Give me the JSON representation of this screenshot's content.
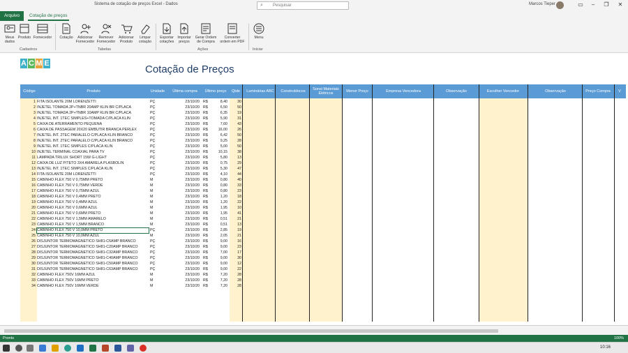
{
  "window": {
    "title": "Sistema de cotação de preços Excel - Dados",
    "user": "Marcos Tieper"
  },
  "search": {
    "placeholder": "Pesquisar"
  },
  "ribbon": {
    "tabs": [
      "Arquivo",
      "Cotação de preços"
    ],
    "buttons": [
      {
        "label": "Meus dados",
        "icon": "user-card-icon"
      },
      {
        "label": "Produto",
        "icon": "product-icon"
      },
      {
        "label": "Fornecedor",
        "icon": "supplier-icon"
      },
      {
        "label": "Cotação",
        "icon": "quote-icon"
      },
      {
        "label": "Adicionar Fornecedor",
        "icon": "add-user-icon"
      },
      {
        "label": "Remover Fornecedor",
        "icon": "remove-user-icon"
      },
      {
        "label": "Adicionar Produto",
        "icon": "add-cart-icon"
      },
      {
        "label": "Limpar cotação",
        "icon": "eraser-icon"
      },
      {
        "label": "Exportar cotações",
        "icon": "export-icon"
      },
      {
        "label": "Importar preços",
        "icon": "import-icon"
      },
      {
        "label": "Gerar Ordem de Compra",
        "icon": "order-icon"
      },
      {
        "label": "Converter ordem em PDF",
        "icon": "pdf-icon"
      },
      {
        "label": "Menu",
        "icon": "menu-icon"
      }
    ],
    "groups": [
      "Cadastros",
      "Tabelas",
      "Ações",
      "Iniciar"
    ]
  },
  "sheet": {
    "logo": [
      "A",
      "C",
      "M",
      "E"
    ],
    "heading": "Cotação de Preços",
    "headers": [
      "Código",
      "Produto",
      "Unidade",
      "Última compra",
      "Último preço",
      "Qtde",
      "Luminárias ABC",
      "Construblocos",
      "Sonsi Materiais Elétricos",
      "Menor Preço",
      "Empresa Vencedora",
      "Observação",
      "Escolher Vencedor",
      "Observação",
      "Preço Compra",
      "V"
    ],
    "rows": [
      {
        "cod": "1",
        "prod": "FITA ISOLANTE 20M LORENZETTI",
        "un": "PÇ",
        "dt": "23/10/20",
        "rs": "R$",
        "pr": "8,40",
        "q": "30"
      },
      {
        "cod": "2",
        "prod": "INJETEL TOMADA 2P+TNBR 20AMP KLIN BR C/PLACA",
        "un": "PÇ",
        "dt": "23/10/20",
        "rs": "R$",
        "pr": "6,50",
        "q": "50"
      },
      {
        "cod": "3",
        "prod": "INJETEL TOMADA 2P+TNBR 10AMP KLIN BR C/PLACA",
        "un": "PÇ",
        "dt": "23/10/20",
        "rs": "R$",
        "pr": "6,35",
        "q": "19"
      },
      {
        "cod": "4",
        "prod": "INJETEL INT. 1TEC SIMPLES+TOMADA C/PLACA KLIN",
        "un": "PÇ",
        "dt": "23/10/20",
        "rs": "R$",
        "pr": "5,90",
        "q": "31"
      },
      {
        "cod": "5",
        "prod": "CAIXA DE ATERRAMENTO PEQUENA",
        "un": "PÇ",
        "dt": "23/10/20",
        "rs": "R$",
        "pr": "7,60",
        "q": "43"
      },
      {
        "cod": "6",
        "prod": "CAIXA DE PASSAGEM 20X20 EMBUTIR BRANCA PERLEX",
        "un": "PÇ",
        "dt": "23/10/20",
        "rs": "R$",
        "pr": "16,00",
        "q": "26"
      },
      {
        "cod": "7",
        "prod": "INJETEL INT. 2TEC PARALELO C/PLACA KLIN BRANCO",
        "un": "PÇ",
        "dt": "23/10/20",
        "rs": "R$",
        "pr": "6,42",
        "q": "50"
      },
      {
        "cod": "8",
        "prod": "INJETEL INT. 2TEC PARALELO C/PLACA KLIN BRANCO",
        "un": "PÇ",
        "dt": "23/10/20",
        "rs": "R$",
        "pr": "9,25",
        "q": "28"
      },
      {
        "cod": "9",
        "prod": "INJETEL INT. 1TEC SIMPLES C/PLACA KLIN",
        "un": "PÇ",
        "dt": "23/10/20",
        "rs": "R$",
        "pr": "5,00",
        "q": "50"
      },
      {
        "cod": "10",
        "prod": "INJETEL TERMINAL COAXIAL PARA TV",
        "un": "PÇ",
        "dt": "23/10/20",
        "rs": "R$",
        "pr": "10,15",
        "q": "38"
      },
      {
        "cod": "11",
        "prod": "LAMPADA TRILUX SHORT 15W G-LIGHT",
        "un": "PÇ",
        "dt": "23/10/20",
        "rs": "R$",
        "pr": "5,80",
        "q": "13"
      },
      {
        "cod": "12",
        "prod": "CAIXA DE LUZ P/TETO 3X4 AMARELA PLASBOLIN",
        "un": "PÇ",
        "dt": "23/10/20",
        "rs": "R$",
        "pr": "0,75",
        "q": "29"
      },
      {
        "cod": "13",
        "prod": "INJETEL INT. 1TEC SIMPLES C/PLACA KLIN",
        "un": "PÇ",
        "dt": "23/10/20",
        "rs": "R$",
        "pr": "5,30",
        "q": "47"
      },
      {
        "cod": "14",
        "prod": "FITA ISOLANTE 20M LORENZETTI",
        "un": "PÇ",
        "dt": "23/10/20",
        "rs": "R$",
        "pr": "4,10",
        "q": "44"
      },
      {
        "cod": "15",
        "prod": "CABINHO FLEX 750 V 0,75MM PRETO",
        "un": "M",
        "dt": "23/10/20",
        "rs": "R$",
        "pr": "0,80",
        "q": "40"
      },
      {
        "cod": "16",
        "prod": "CABINHO FLEX 750 V 0,75MM VERDE",
        "un": "M",
        "dt": "23/10/20",
        "rs": "R$",
        "pr": "0,80",
        "q": "33"
      },
      {
        "cod": "17",
        "prod": "CABINHO FLEX 750 V 0,75MM AZUL",
        "un": "M",
        "dt": "23/10/20",
        "rs": "R$",
        "pr": "0,80",
        "q": "23"
      },
      {
        "cod": "18",
        "prod": "CABINHO FLEX 750 V 0,4MM PRETO",
        "un": "M",
        "dt": "23/10/20",
        "rs": "R$",
        "pr": "1,20",
        "q": "18"
      },
      {
        "cod": "19",
        "prod": "CABINHO FLEX 750 V 0,4MM AZUL",
        "un": "M",
        "dt": "23/10/20",
        "rs": "R$",
        "pr": "1,20",
        "q": "22"
      },
      {
        "cod": "20",
        "prod": "CABINHO FLEX 750 V 0,6MM AZUL",
        "un": "M",
        "dt": "23/10/20",
        "rs": "R$",
        "pr": "1,95",
        "q": "10"
      },
      {
        "cod": "21",
        "prod": "CABINHO FLEX 750 V 0,6MM PRETO",
        "un": "M",
        "dt": "23/10/20",
        "rs": "R$",
        "pr": "1,95",
        "q": "41"
      },
      {
        "cod": "22",
        "prod": "CABINHO FLEX 750 V 1,5MM AMARELO",
        "un": "M",
        "dt": "23/10/20",
        "rs": "R$",
        "pr": "0,51",
        "q": "21"
      },
      {
        "cod": "23",
        "prod": "CABINHO FLEX 750 V 1,5MM BRANCO",
        "un": "M",
        "dt": "23/10/20",
        "rs": "R$",
        "pr": "0,51",
        "q": "13"
      },
      {
        "cod": "24",
        "prod": "CABINHO FLEX 750 V 10,0MM PRETO",
        "un": "PÇ",
        "dt": "23/10/20",
        "rs": "R$",
        "pr": "2,85",
        "q": "19"
      },
      {
        "cod": "25",
        "prod": "CABINHO FLEX 750 V 10,0MM AZUL",
        "un": "M",
        "dt": "23/10/20",
        "rs": "R$",
        "pr": "2,05",
        "q": "21"
      },
      {
        "cod": "26",
        "prod": "DISJUNTOR TERMOMAGNETICO SH81-C6AMP BRANCO",
        "un": "PÇ",
        "dt": "23/10/20",
        "rs": "R$",
        "pr": "9,00",
        "q": "16"
      },
      {
        "cod": "27",
        "prod": "DISJUNTOR TERMOMAGNETICO SH81-C20AMP BRANCO",
        "un": "PÇ",
        "dt": "23/10/20",
        "rs": "R$",
        "pr": "9,00",
        "q": "23"
      },
      {
        "cod": "28",
        "prod": "DISJUNTOR TERMOMAGNETICO SH81-C32AMP BRANCO",
        "un": "PÇ",
        "dt": "23/10/20",
        "rs": "R$",
        "pr": "7,00",
        "q": "17"
      },
      {
        "cod": "29",
        "prod": "DISJUNTOR TERMOMAGNETICO SH81-C40AMP BRANCO",
        "un": "PÇ",
        "dt": "23/10/20",
        "rs": "R$",
        "pr": "9,00",
        "q": "30"
      },
      {
        "cod": "30",
        "prod": "DISJUNTOR TERMOMAGNETICO SH81-C50AMP BRANCO",
        "un": "PÇ",
        "dt": "23/10/20",
        "rs": "R$",
        "pr": "9,00",
        "q": "12"
      },
      {
        "cod": "31",
        "prod": "DISJUNTOR TERMOMAGNETICO SH81-C63AMP BRANCO",
        "un": "PÇ",
        "dt": "23/10/20",
        "rs": "R$",
        "pr": "9,00",
        "q": "22"
      },
      {
        "cod": "32",
        "prod": "CABINHO FLEX 750V 16MM AZUL",
        "un": "M",
        "dt": "23/10/20",
        "rs": "R$",
        "pr": "7,20",
        "q": "28"
      },
      {
        "cod": "33",
        "prod": "CABINHO FLEX 750V 16MM PRETO",
        "un": "M",
        "dt": "23/10/20",
        "rs": "R$",
        "pr": "7,20",
        "q": "28"
      },
      {
        "cod": "34",
        "prod": "CABINHO FLEX 750V 16MM VERDE",
        "un": "M",
        "dt": "23/10/20",
        "rs": "R$",
        "pr": "7,20",
        "q": "28"
      }
    ]
  },
  "status": {
    "left": "Pronto",
    "zoom": "100%"
  },
  "taskbar": {
    "time": "10:16"
  },
  "colors": {
    "excel_green": "#217346",
    "header_blue": "#5b9bd5",
    "highlight_yellow": "#fff2cc"
  }
}
